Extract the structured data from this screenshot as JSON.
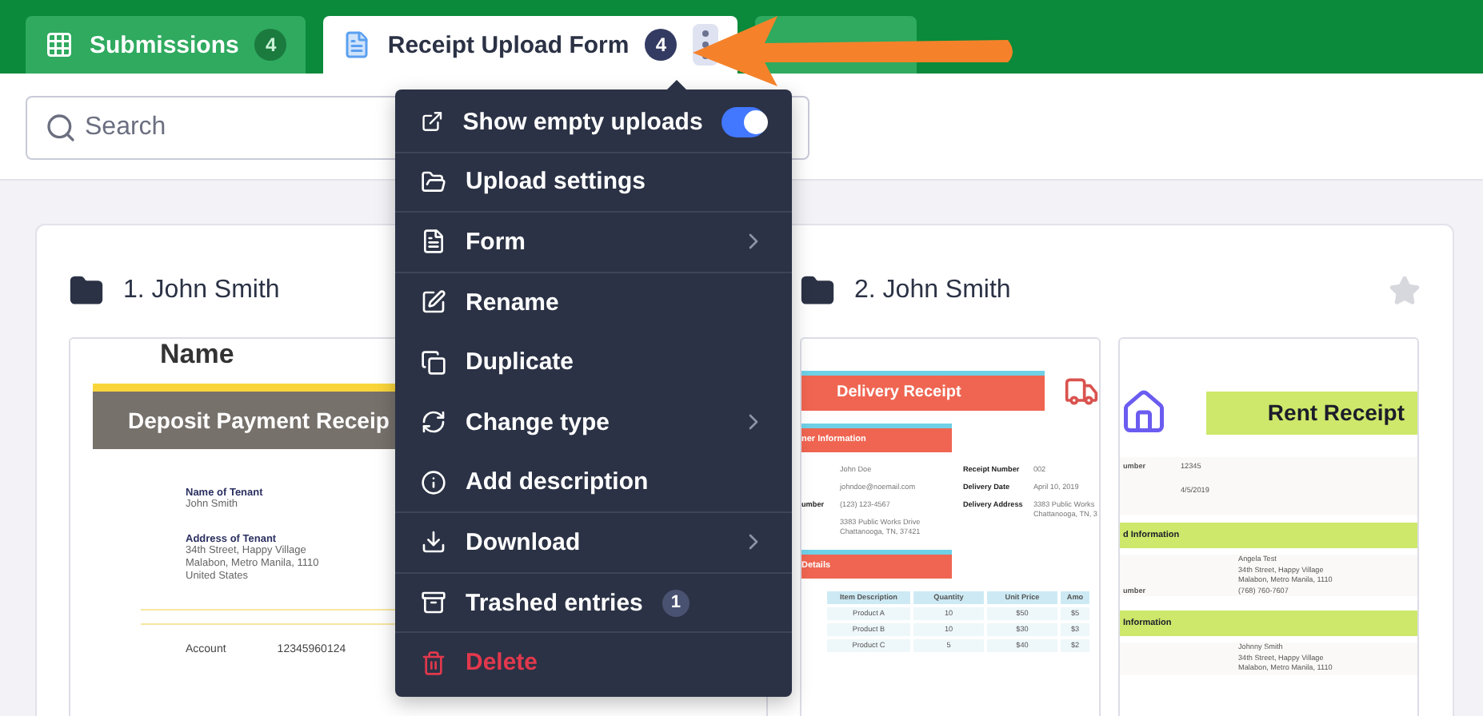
{
  "tabs": [
    {
      "label": "Submissions",
      "count": "4",
      "selected": false,
      "kind": "grid"
    },
    {
      "label": "Receipt Upload Form",
      "count": "4",
      "selected": true,
      "kind": "form"
    },
    {
      "kind": "add",
      "selected": false
    }
  ],
  "search": {
    "placeholder": "Search"
  },
  "groups": [
    {
      "title": "1. John Smith",
      "thumbnails": [
        {
          "kind": "deposit",
          "top": "Name",
          "banner": "Deposit Payment Receip",
          "fields": [
            {
              "label": "Name of Tenant",
              "lines": [
                "John Smith"
              ]
            },
            {
              "label": "Address of Tenant",
              "lines": [
                "34th Street, Happy Village",
                "Malabon, Metro Manila, 1110",
                "United States"
              ]
            }
          ],
          "account_label": "Account",
          "account_value": "12345960124"
        }
      ]
    },
    {
      "title": "2. John Smith",
      "starred": false,
      "thumbnails": [
        {
          "kind": "delivery",
          "banner": "Delivery Receipt",
          "section": "ner Information",
          "customer": [
            {
              "value": "John Doe"
            },
            {
              "value": "johndoe@noemail.com"
            },
            {
              "label": "umber",
              "value": "(123) 123-4567"
            },
            {
              "value": "3383 Public Works Drive\nChattanooga, TN, 37421"
            }
          ],
          "receipt": [
            {
              "label": "Receipt Number",
              "value": "002"
            },
            {
              "label": "Delivery Date",
              "value": "April 10, 2019"
            },
            {
              "label": "Delivery Address",
              "value": "3383 Public Works\nChattanooga, TN, 3"
            }
          ],
          "details": "Details",
          "columns": [
            "Item Description",
            "Quantity",
            "Unit Price",
            "Amo"
          ],
          "items": [
            [
              "Product A",
              "10",
              "$50",
              "$5"
            ],
            [
              "Product B",
              "10",
              "$30",
              "$3"
            ],
            [
              "Product C",
              "5",
              "$40",
              "$2"
            ]
          ]
        },
        {
          "kind": "rent",
          "banner": "Rent Receipt",
          "top_rows": [
            [
              "umber",
              "12345"
            ],
            [
              "",
              "4/5/2019"
            ]
          ],
          "sections": [
            {
              "title": "d Information",
              "rows": [
                [
                  "",
                  "Angela Test"
                ],
                [
                  "",
                  "34th Street, Happy Village"
                ],
                [
                  "",
                  "Malabon, Metro Manila, 1110"
                ],
                [
                  "umber",
                  "(768) 760-7607"
                ]
              ]
            },
            {
              "title": "Information",
              "rows": [
                [
                  "",
                  "Johnny Smith"
                ],
                [
                  "",
                  "34th Street, Happy Village"
                ],
                [
                  "",
                  "Malabon, Metro Manila, 1110"
                ]
              ]
            }
          ]
        }
      ]
    }
  ],
  "menu": {
    "items": [
      {
        "kind": "toggle",
        "label": "Show empty uploads",
        "on": true
      },
      {
        "kind": "plain",
        "label": "Upload settings"
      },
      {
        "kind": "submenu",
        "label": "Form"
      },
      {
        "kind": "plain",
        "label": "Rename"
      },
      {
        "kind": "plain",
        "label": "Duplicate"
      },
      {
        "kind": "submenu",
        "label": "Change type"
      },
      {
        "kind": "plain",
        "label": "Add description"
      },
      {
        "kind": "submenu",
        "label": "Download"
      },
      {
        "kind": "count",
        "label": "Trashed entries",
        "count": "1"
      },
      {
        "kind": "danger",
        "label": "Delete"
      }
    ]
  }
}
